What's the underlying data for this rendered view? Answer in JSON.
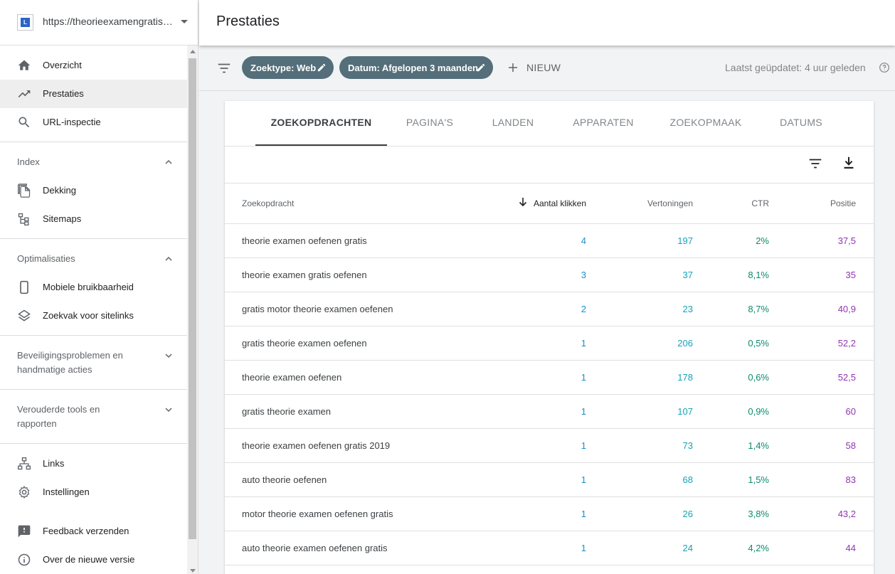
{
  "property": {
    "url": "https://theorieexamengratisoefenen.nl",
    "logo_letter": "L"
  },
  "sidebar": {
    "top_items": [
      {
        "label": "Overzicht",
        "icon": "home-icon"
      },
      {
        "label": "Prestaties",
        "icon": "trending-up-icon",
        "active": true
      },
      {
        "label": "URL-inspectie",
        "icon": "search-icon"
      }
    ],
    "sections": {
      "index": {
        "title": "Index",
        "items": [
          {
            "label": "Dekking",
            "icon": "copy-icon"
          },
          {
            "label": "Sitemaps",
            "icon": "sitemap-icon"
          }
        ]
      },
      "optimalisaties": {
        "title": "Optimalisaties",
        "items": [
          {
            "label": "Mobiele bruikbaarheid",
            "icon": "smartphone-icon"
          },
          {
            "label": "Zoekvak voor sitelinks",
            "icon": "layers-icon"
          }
        ]
      },
      "beveiliging": {
        "title_line1": "Beveiligingsproblemen en",
        "title_line2": "handmatige acties"
      },
      "verouderd": {
        "title_line1": "Verouderde tools en",
        "title_line2": "rapporten"
      }
    },
    "bottom_items": [
      {
        "label": "Links",
        "icon": "links-icon"
      },
      {
        "label": "Instellingen",
        "icon": "gear-icon"
      },
      {
        "label": "Feedback verzenden",
        "icon": "feedback-icon"
      },
      {
        "label": "Over de nieuwe versie",
        "icon": "info-icon"
      }
    ]
  },
  "header": {
    "title": "Prestaties"
  },
  "filters": {
    "chips": [
      {
        "label": "Zoektype: Web"
      },
      {
        "label": "Datum: Afgelopen 3 maanden"
      }
    ],
    "new_label": "NIEUW",
    "updated": "Laatst geüpdatet: 4 uur geleden"
  },
  "tabs": [
    "ZOEKOPDRACHTEN",
    "PAGINA'S",
    "LANDEN",
    "APPARATEN",
    "ZOEKOPMAAK",
    "DATUMS"
  ],
  "table": {
    "headers": {
      "query": "Zoekopdracht",
      "clicks": "Aantal klikken",
      "impressions": "Vertoningen",
      "ctr": "CTR",
      "position": "Positie"
    },
    "rows": [
      {
        "query": "theorie examen oefenen gratis",
        "clicks": "4",
        "impressions": "197",
        "ctr": "2%",
        "position": "37,5"
      },
      {
        "query": "theorie examen gratis oefenen",
        "clicks": "3",
        "impressions": "37",
        "ctr": "8,1%",
        "position": "35"
      },
      {
        "query": "gratis motor theorie examen oefenen",
        "clicks": "2",
        "impressions": "23",
        "ctr": "8,7%",
        "position": "40,9"
      },
      {
        "query": "gratis theorie examen oefenen",
        "clicks": "1",
        "impressions": "206",
        "ctr": "0,5%",
        "position": "52,2"
      },
      {
        "query": "theorie examen oefenen",
        "clicks": "1",
        "impressions": "178",
        "ctr": "0,6%",
        "position": "52,5"
      },
      {
        "query": "gratis theorie examen",
        "clicks": "1",
        "impressions": "107",
        "ctr": "0,9%",
        "position": "60"
      },
      {
        "query": "theorie examen oefenen gratis 2019",
        "clicks": "1",
        "impressions": "73",
        "ctr": "1,4%",
        "position": "58"
      },
      {
        "query": "auto theorie oefenen",
        "clicks": "1",
        "impressions": "68",
        "ctr": "1,5%",
        "position": "83"
      },
      {
        "query": "motor theorie examen oefenen gratis",
        "clicks": "1",
        "impressions": "26",
        "ctr": "3,8%",
        "position": "43,2"
      },
      {
        "query": "auto theorie examen oefenen gratis",
        "clicks": "1",
        "impressions": "24",
        "ctr": "4,2%",
        "position": "44"
      }
    ]
  },
  "colors": {
    "clicks": "#1a8fc9",
    "impressions": "#14a3b8",
    "ctr": "#0e8a6e",
    "position": "#9334b3",
    "chip_bg": "#546e7a"
  }
}
